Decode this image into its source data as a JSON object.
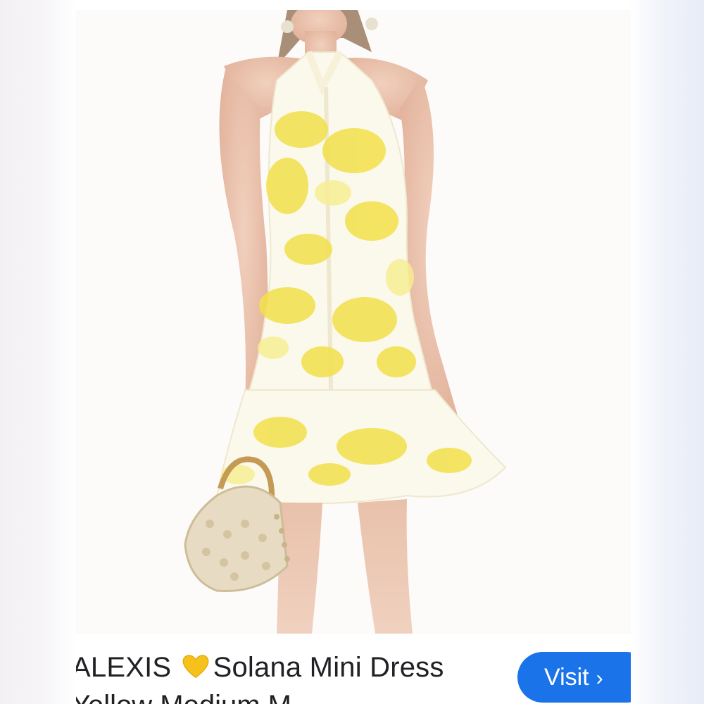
{
  "listing": {
    "title_line1_brand": "ALEXIS",
    "title_line1_emoji": "yellow-heart",
    "title_line1_rest": "Solana Mini Dress",
    "title_line2": "Yellow Medium M",
    "image_alt": "Yellow floral halter mini dress on model holding a beaded bag"
  },
  "actions": {
    "visit_label": "Visit",
    "visit_icon": "chevron-right-icon",
    "accent_color": "#1a73e8"
  },
  "colors": {
    "dress_yellow": "#f2e04a",
    "dress_white": "#fbf8ec",
    "heart": "#f7c11b"
  }
}
